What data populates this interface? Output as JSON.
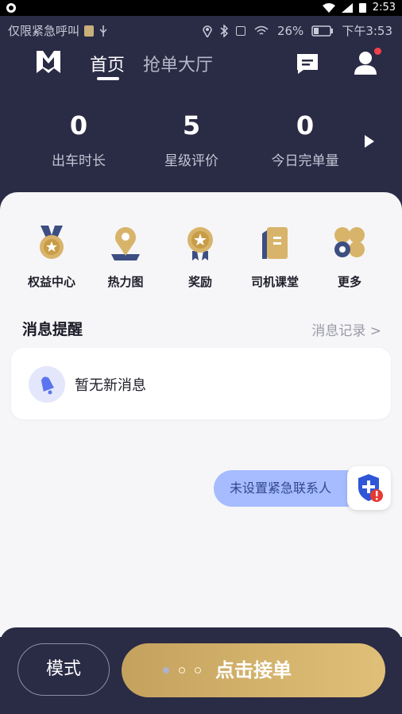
{
  "status": {
    "time": "2:53"
  },
  "sysbar": {
    "left_text": "仅限紧急呼叫",
    "battery": "26%",
    "time": "下午3:53"
  },
  "nav": {
    "tabs": [
      {
        "label": "首页",
        "active": true
      },
      {
        "label": "抢单大厅",
        "active": false
      }
    ],
    "message_icon": "chat-icon",
    "user_icon": "user-icon",
    "user_badge": true
  },
  "stats": [
    {
      "value": "0",
      "label": "出车时长"
    },
    {
      "value": "5",
      "label": "星级评价"
    },
    {
      "value": "0",
      "label": "今日完单量"
    }
  ],
  "shortcuts": [
    {
      "label": "权益中心",
      "icon": "medal-icon"
    },
    {
      "label": "热力图",
      "icon": "map-pin-icon"
    },
    {
      "label": "奖励",
      "icon": "award-icon"
    },
    {
      "label": "司机课堂",
      "icon": "book-icon"
    },
    {
      "label": "更多",
      "icon": "more-icon"
    }
  ],
  "messages": {
    "title": "消息提醒",
    "link": "消息记录 >",
    "empty": "暂无新消息"
  },
  "emergency": {
    "text": "未设置紧急联系人"
  },
  "bottom": {
    "mode_label": "模式",
    "accept_label": "点击接单",
    "carousel_dots": 3,
    "carousel_active_index": 0
  },
  "colors": {
    "primary_bg": "#2a2b45",
    "gold": "#d8b46a",
    "pill": "#a6bcff",
    "alert": "#e53935"
  }
}
